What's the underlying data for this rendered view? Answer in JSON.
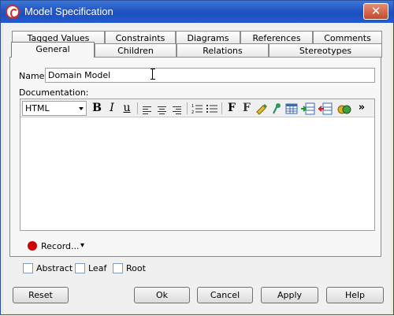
{
  "window": {
    "title": "Model Specification",
    "close_symbol": "✕"
  },
  "tabs_row_back": [
    "Tagged Values",
    "Constraints",
    "Diagrams",
    "References",
    "Comments"
  ],
  "tabs_row_front": [
    "General",
    "Children",
    "Relations",
    "Stereotypes"
  ],
  "active_tab": "General",
  "form": {
    "name_label": "Name:",
    "name_value": "Domain Model",
    "documentation_label": "Documentation:"
  },
  "editor": {
    "format_value": "HTML",
    "bold": "B",
    "italic": "I",
    "underline": "u",
    "font_btn": "F",
    "font_color_btn": "F",
    "more_btn": "»",
    "content": ""
  },
  "record": {
    "label": "Record...",
    "menu_arrow": "▾"
  },
  "checkboxes": [
    {
      "label": "Abstract",
      "checked": false
    },
    {
      "label": "Leaf",
      "checked": false
    },
    {
      "label": "Root",
      "checked": false
    }
  ],
  "buttons": {
    "reset": "Reset",
    "ok": "Ok",
    "cancel": "Cancel",
    "apply": "Apply",
    "help": "Help"
  },
  "colors": {
    "titlebar": "#245bd0",
    "record": "#cc0000"
  }
}
